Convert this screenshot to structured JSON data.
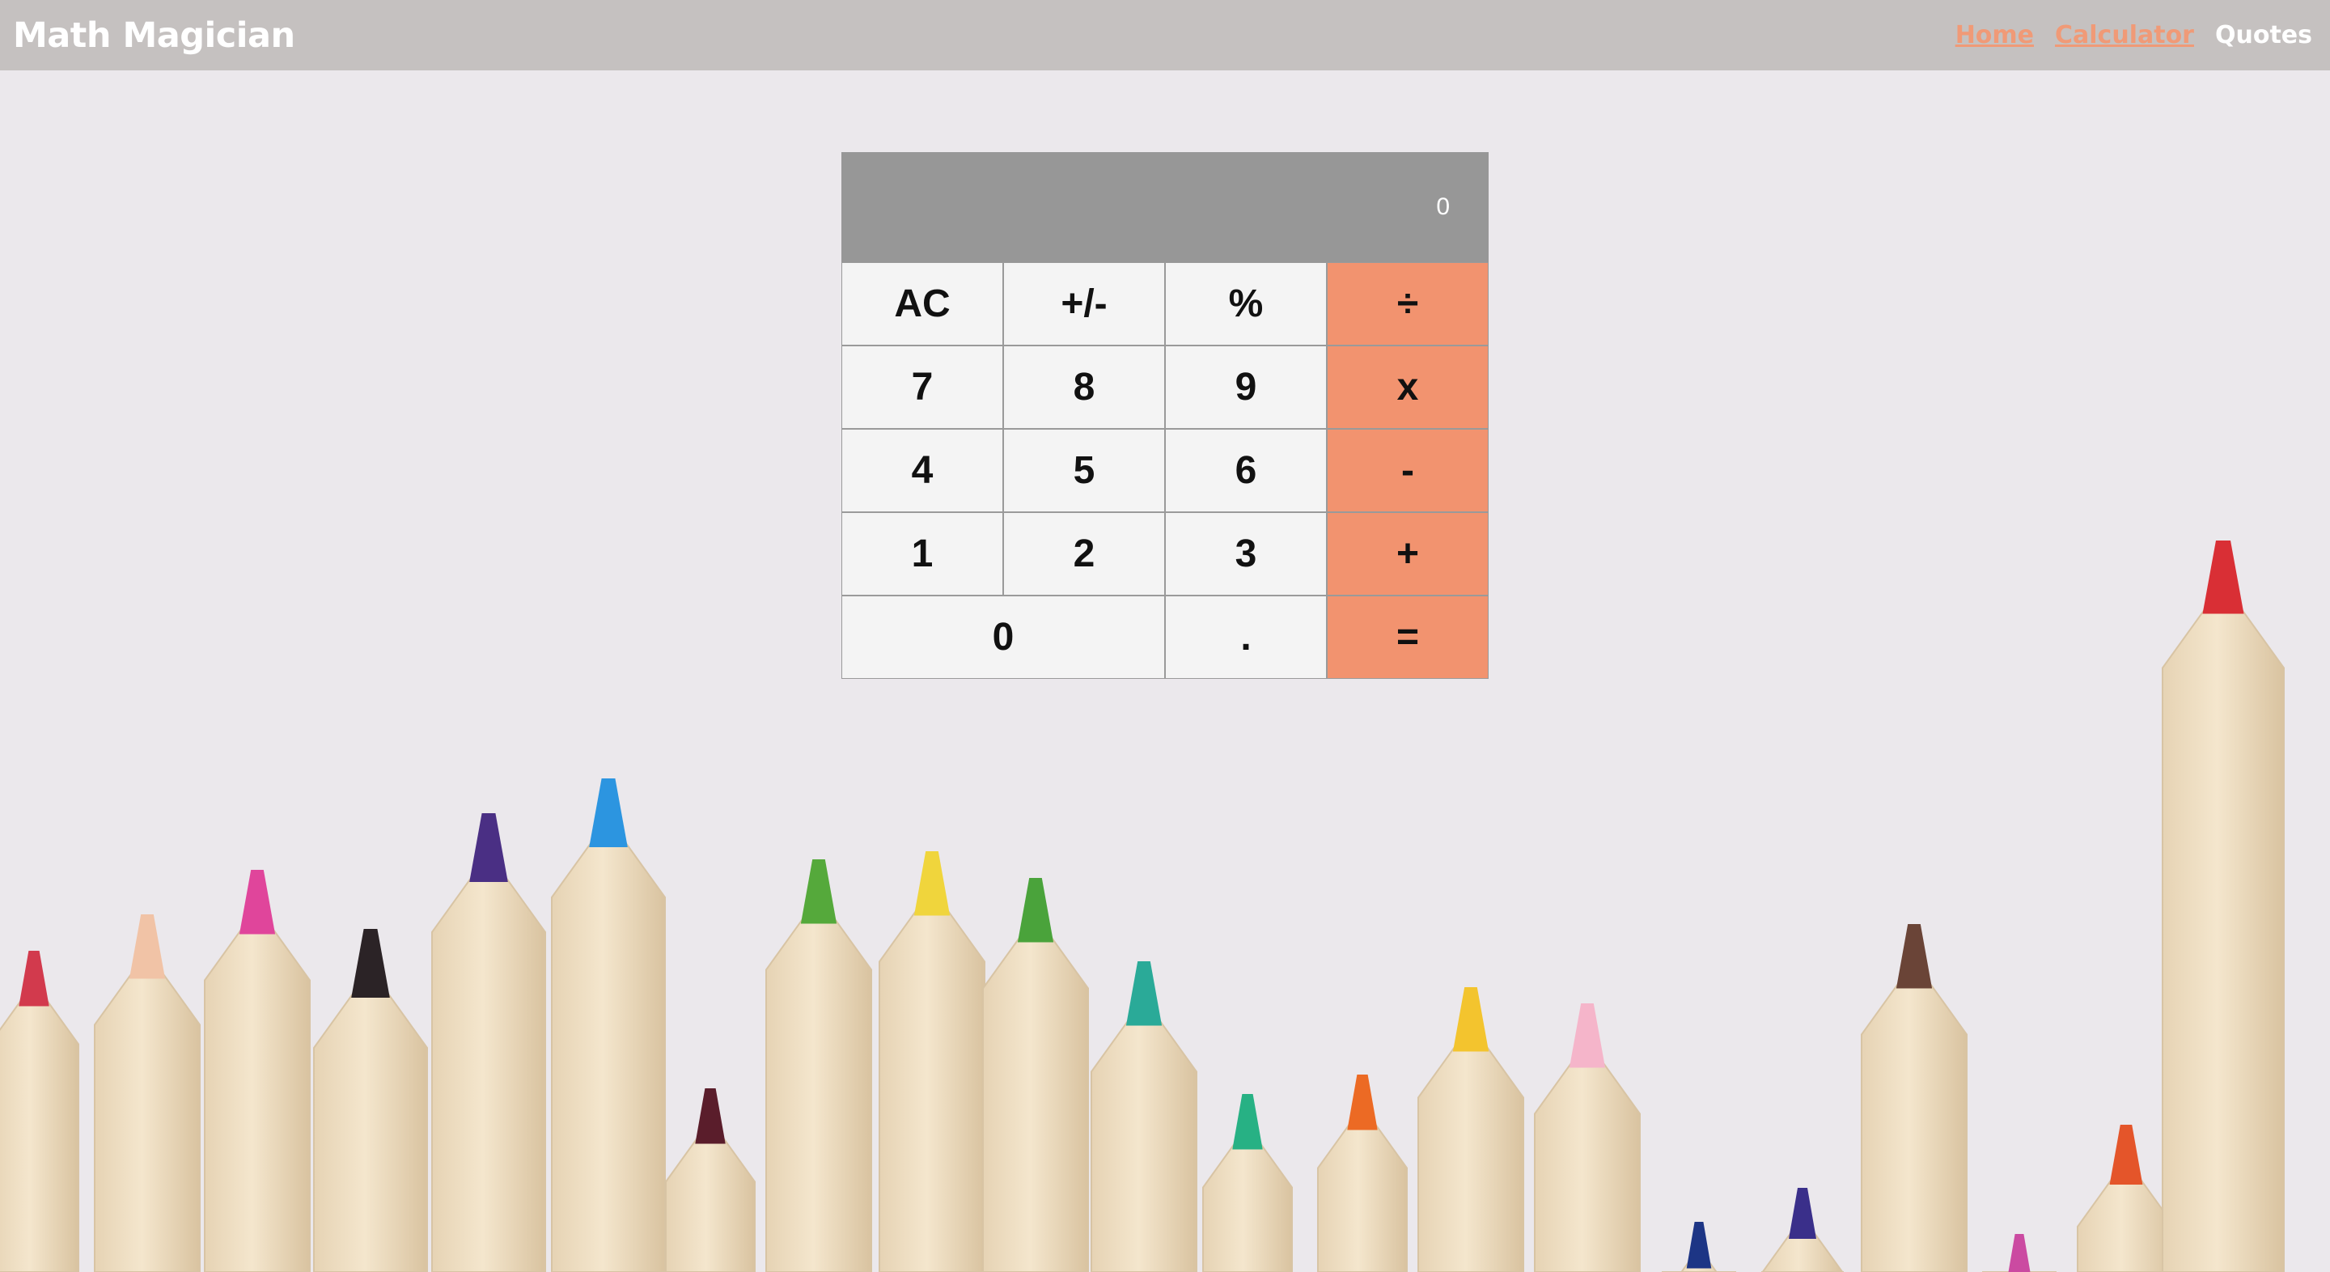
{
  "navbar": {
    "brand": "Math Magician",
    "links": [
      {
        "label": "Home"
      },
      {
        "label": "Calculator"
      },
      {
        "label": "Quotes"
      }
    ]
  },
  "calculator": {
    "display_value": "0",
    "keys": {
      "ac": "AC",
      "sign": "+/-",
      "percent": "%",
      "divide": "÷",
      "seven": "7",
      "eight": "8",
      "nine": "9",
      "multiply": "x",
      "four": "4",
      "five": "5",
      "six": "6",
      "subtract": "-",
      "one": "1",
      "two": "2",
      "three": "3",
      "add": "+",
      "zero": "0",
      "decimal": ".",
      "equals": "="
    }
  },
  "colors": {
    "navbar_bg": "#c5c1c0",
    "accent": "#f09a77",
    "operator_key": "#f2936f",
    "display_bg": "#979797",
    "key_bg": "#f4f4f4"
  }
}
